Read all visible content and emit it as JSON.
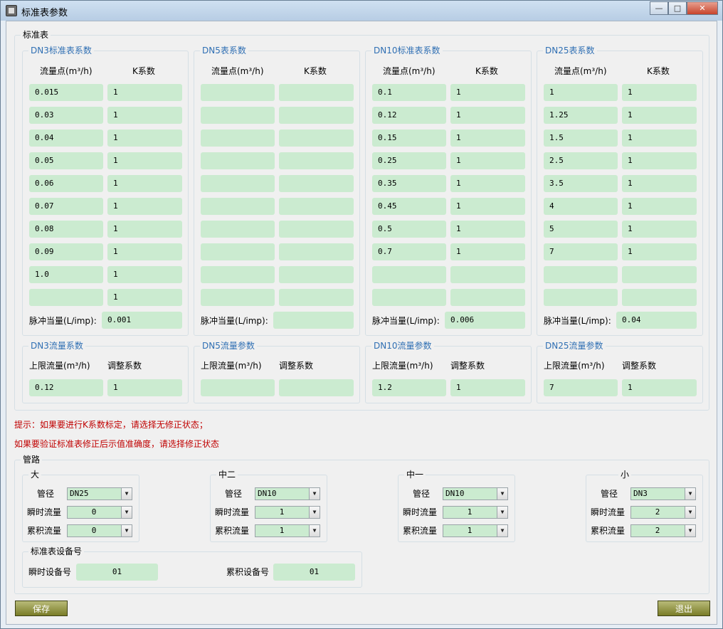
{
  "window": {
    "title": "标准表参数",
    "buttons": [
      "—",
      "□",
      "✕"
    ]
  },
  "std_meter": {
    "title": "标准表",
    "col_flow": "流量点(m³/h)",
    "col_k": "K系数",
    "pulse_label": "脉冲当量(L/imp):",
    "limit_label": "上限流量(m³/h)",
    "adjust_label": "调整系数",
    "panels": [
      {
        "title": "DN3标准表系数",
        "flow": [
          "0.015",
          "0.03",
          "0.04",
          "0.05",
          "0.06",
          "0.07",
          "0.08",
          "0.09",
          "1.0",
          ""
        ],
        "k": [
          "1",
          "1",
          "1",
          "1",
          "1",
          "1",
          "1",
          "1",
          "1",
          "1"
        ],
        "pulse": "0.001",
        "param_title": "DN3流量系数",
        "limit": "0.12",
        "adjust": "1"
      },
      {
        "title": "DN5表系数",
        "flow": [
          "",
          "",
          "",
          "",
          "",
          "",
          "",
          "",
          "",
          ""
        ],
        "k": [
          "",
          "",
          "",
          "",
          "",
          "",
          "",
          "",
          "",
          ""
        ],
        "pulse": "",
        "param_title": "DN5流量参数",
        "limit": "",
        "adjust": ""
      },
      {
        "title": "DN10标准表系数",
        "flow": [
          "0.1",
          "0.12",
          "0.15",
          "0.25",
          "0.35",
          "0.45",
          "0.5",
          "0.7",
          "",
          ""
        ],
        "k": [
          "1",
          "1",
          "1",
          "1",
          "1",
          "1",
          "1",
          "1",
          "",
          ""
        ],
        "pulse": "0.006",
        "param_title": "DN10流量参数",
        "limit": "1.2",
        "adjust": "1"
      },
      {
        "title": "DN25表系数",
        "flow": [
          "1",
          "1.25",
          "1.5",
          "2.5",
          "3.5",
          "4",
          "5",
          "7",
          "",
          ""
        ],
        "k": [
          "1",
          "1",
          "1",
          "1",
          "1",
          "1",
          "1",
          "1",
          "",
          ""
        ],
        "pulse": "0.04",
        "param_title": "DN25流量参数",
        "limit": "7",
        "adjust": "1"
      }
    ]
  },
  "hints": [
    "提示：如果要进行K系数标定，请选择无修正状态；",
    "如果要验证标准表修正后示值准确度，请选择修正状态"
  ],
  "pipeline": {
    "title": "管路",
    "label_dia": "管径",
    "label_inst": "瞬时流量",
    "label_cum": "累积流量",
    "groups": [
      {
        "title": "大",
        "dia": "DN25",
        "inst": "0",
        "cum": "0"
      },
      {
        "title": "中二",
        "dia": "DN10",
        "inst": "1",
        "cum": "1"
      },
      {
        "title": "中一",
        "dia": "DN10",
        "inst": "1",
        "cum": "1"
      },
      {
        "title": "小",
        "dia": "DN3",
        "inst": "2",
        "cum": "2"
      }
    ],
    "device": {
      "title": "标准表设备号",
      "inst_label": "瞬时设备号",
      "inst_value": "01",
      "cum_label": "累积设备号",
      "cum_value": "01"
    }
  },
  "actions": {
    "save": "保存",
    "exit": "退出"
  }
}
